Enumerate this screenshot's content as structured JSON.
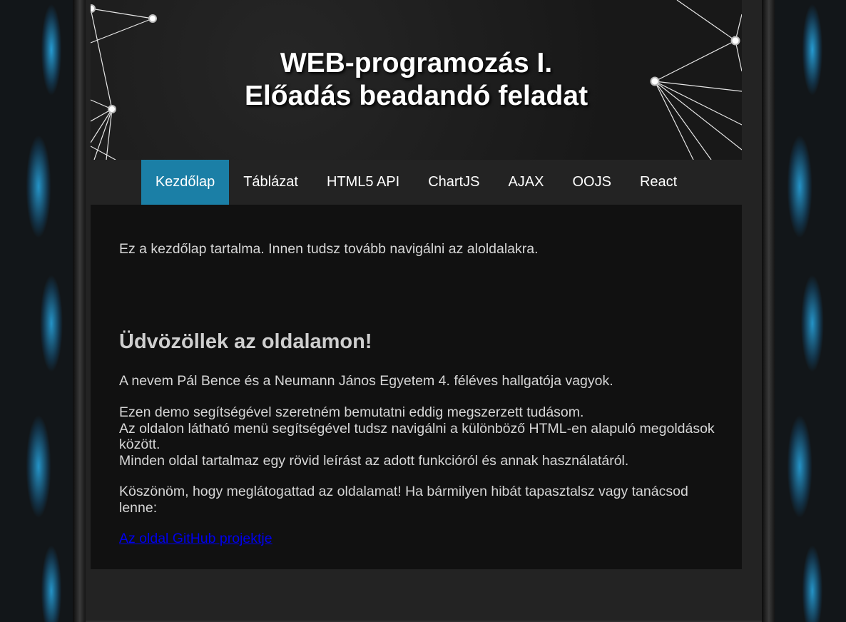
{
  "header": {
    "title_line1": "WEB-programozás I.",
    "title_line2": "Előadás beadandó feladat"
  },
  "nav": {
    "items": [
      {
        "label": "Kezdőlap",
        "active": true
      },
      {
        "label": "Táblázat",
        "active": false
      },
      {
        "label": "HTML5 API",
        "active": false
      },
      {
        "label": "ChartJS",
        "active": false
      },
      {
        "label": "AJAX",
        "active": false
      },
      {
        "label": "OOJS",
        "active": false
      },
      {
        "label": "React",
        "active": false
      }
    ]
  },
  "content": {
    "intro": "Ez a kezdőlap tartalma. Innen tudsz tovább navigálni az aloldalakra.",
    "welcome_heading": "Üdvözöllek az oldalamon!",
    "paragraph1": "A nevem Pál Bence és a Neumann János Egyetem 4. féléves hallgatója vagyok.",
    "paragraph2_lines": [
      "Ezen demo segítségével szeretném bemutatni eddig megszerzett tudásom.",
      "Az oldalon látható menü segítségével tudsz navigálni a különböző HTML-en alapuló megoldások között.",
      "Minden oldal tartalmaz egy rövid leírást az adott funkcióról és annak használatáról."
    ],
    "paragraph3": "Köszönöm, hogy meglátogattad az oldalamat! Ha bármilyen hibát tapasztalsz vagy tanácsod lenne:",
    "github_link": "Az oldal GitHub projektje"
  },
  "colors": {
    "accent": "#1b7fa6",
    "link": "#0000ee",
    "side_glow": "#28aae6"
  }
}
